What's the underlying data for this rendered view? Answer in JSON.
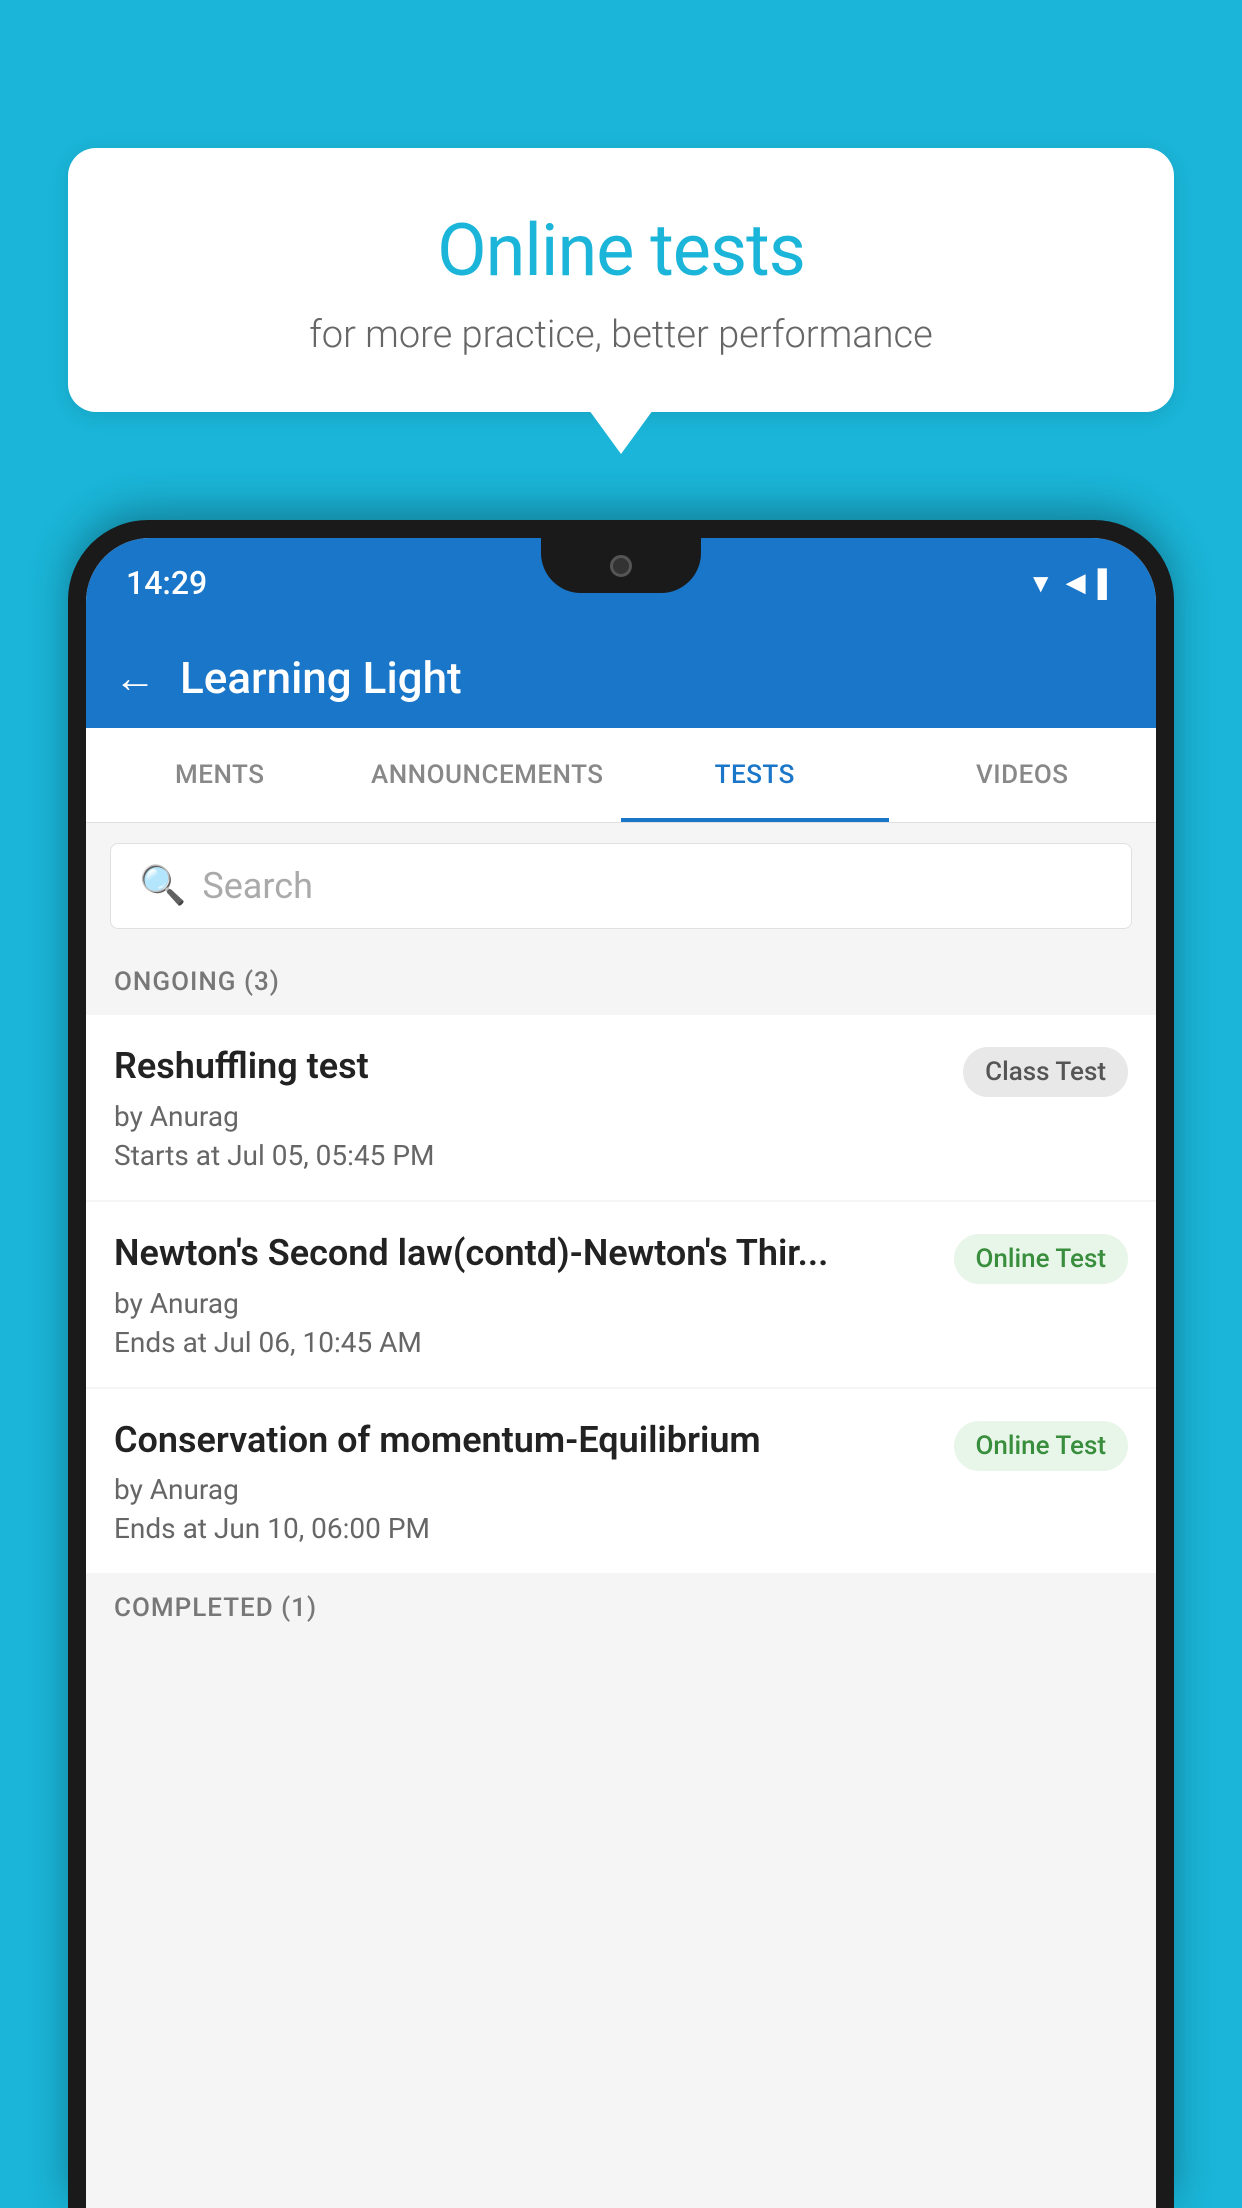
{
  "background_color": "#1ab5d8",
  "bubble": {
    "title": "Online tests",
    "subtitle": "for more practice, better performance"
  },
  "phone": {
    "status_bar": {
      "time": "14:29",
      "icons": [
        "▼",
        "◄",
        "▌"
      ]
    },
    "app_bar": {
      "title": "Learning Light",
      "back_label": "←"
    },
    "tabs": [
      {
        "label": "MENTS",
        "active": false
      },
      {
        "label": "ANNOUNCEMENTS",
        "active": false
      },
      {
        "label": "TESTS",
        "active": true
      },
      {
        "label": "VIDEOS",
        "active": false
      }
    ],
    "search": {
      "placeholder": "Search"
    },
    "sections": [
      {
        "header": "ONGOING (3)",
        "items": [
          {
            "name": "Reshuffling test",
            "author": "by Anurag",
            "time_label": "Starts at",
            "time": "Jul 05, 05:45 PM",
            "badge": "Class Test",
            "badge_type": "class"
          },
          {
            "name": "Newton's Second law(contd)-Newton's Thir...",
            "author": "by Anurag",
            "time_label": "Ends at",
            "time": "Jul 06, 10:45 AM",
            "badge": "Online Test",
            "badge_type": "online"
          },
          {
            "name": "Conservation of momentum-Equilibrium",
            "author": "by Anurag",
            "time_label": "Ends at",
            "time": "Jun 10, 06:00 PM",
            "badge": "Online Test",
            "badge_type": "online"
          }
        ]
      }
    ],
    "completed_header": "COMPLETED (1)"
  }
}
